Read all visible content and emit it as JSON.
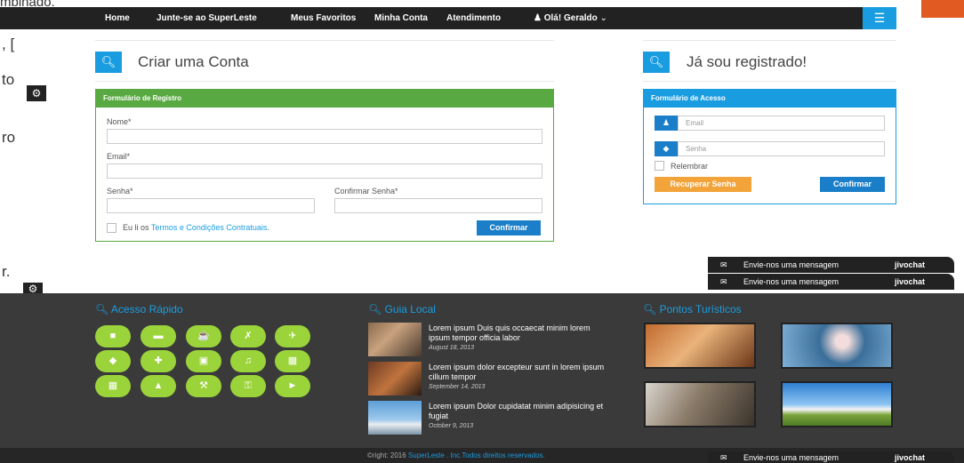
{
  "bleed": {
    "top_text": "mbinado.",
    "left_fragments": [
      ", [",
      "to",
      "ro",
      "r."
    ]
  },
  "nav": {
    "items": [
      "Home",
      "Junte-se ao SuperLeste",
      "Meus Favoritos",
      "Minha Conta",
      "Atendimento"
    ],
    "user_label": "Olá! Geraldo"
  },
  "register": {
    "title": "Criar uma Conta",
    "form_header": "Formulário de Registro",
    "name_label": "Nome*",
    "email_label": "Email*",
    "password_label": "Senha*",
    "confirm_password_label": "Confirmar Senha*",
    "terms_prefix": "Eu li os ",
    "terms_link": "Termos e Condições Contratuais",
    "terms_suffix": ".",
    "submit_label": "Confirmar"
  },
  "login": {
    "title": "Já sou registrado!",
    "form_header": "Formulário de Acesso",
    "email_placeholder": "Email",
    "password_placeholder": "Senha",
    "remember_label": "Relembrar",
    "recover_label": "Recuperar Senha",
    "submit_label": "Confirmar"
  },
  "chat": {
    "message": "Envie-nos uma mensagem",
    "brand": "jivochat"
  },
  "footer": {
    "quick_access_title": "Acesso Rápido",
    "local_guide_title": "Guia Local",
    "tourist_title": "Pontos Turísticos",
    "news": [
      {
        "title": "Lorem ipsum Duis quis occaecat minim lorem ipsum tempor officia labor",
        "date": "August 18, 2013"
      },
      {
        "title": "Lorem ipsum dolor excepteur sunt in lorem ipsum cillum tempor",
        "date": "September 14, 2013"
      },
      {
        "title": "Lorem ipsum Dolor cupidatat minim adipisicing et fugiat",
        "date": "October 9, 2013"
      }
    ],
    "copyright_prefix": "©right: 2016 ",
    "copyright_link": "SuperLeste . Inc.Todos direitos reservados."
  },
  "colors": {
    "accent": "#1a9de0",
    "green": "#59a942",
    "orange": "#f2a33a",
    "lime": "#9bd43a",
    "footer": "#3a3a3a"
  }
}
